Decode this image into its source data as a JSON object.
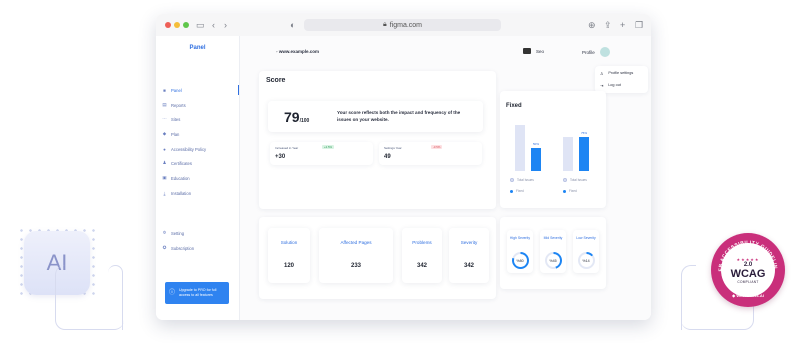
{
  "decor": {
    "ai_label": "AI"
  },
  "browser": {
    "url": "figma.com"
  },
  "app": {
    "site_url": "www.example.com",
    "sidebar": {
      "title": "Panel",
      "items": [
        {
          "label": "Panel",
          "icon": "dashboard-icon"
        },
        {
          "label": "Reports",
          "icon": "reports-icon"
        },
        {
          "label": "Sites",
          "icon": "sites-icon"
        },
        {
          "label": "Plan",
          "icon": "plan-icon"
        },
        {
          "label": "Accessibility Policy",
          "icon": "policy-icon"
        },
        {
          "label": "Certificates",
          "icon": "certificate-icon"
        },
        {
          "label": "Education",
          "icon": "education-icon"
        },
        {
          "label": "Installation",
          "icon": "installation-icon"
        },
        {
          "label": "Setting",
          "icon": "settings-icon"
        },
        {
          "label": "Subscription",
          "icon": "subscription-icon"
        }
      ],
      "upgrade_text": "Upgrade to PRO for full access to all features"
    },
    "header": {
      "lang_label": "Seo",
      "profile_label": "Profile"
    },
    "profile_menu": {
      "items": [
        "Profile settings",
        "Log out"
      ]
    },
    "score": {
      "title": "Score",
      "value": "79",
      "max": "/100",
      "description": "Your score reflects both the impact and frequency of the issues on your website.",
      "stats": [
        {
          "label": "Increased in Year",
          "delta": "+2.5%",
          "value": "+30"
        },
        {
          "label": "Settings Year",
          "delta": "-3.5%",
          "value": "49"
        }
      ]
    },
    "fixed": {
      "title": "Fixed",
      "legend": [
        "Total Issues",
        "Fixed"
      ]
    },
    "summary": {
      "headers": [
        "Solution",
        "Affected Pages",
        "Problems",
        "Severity"
      ],
      "values": [
        "120",
        "233",
        "342",
        "342"
      ]
    },
    "severity": [
      {
        "label": "High Severity",
        "value": "%80"
      },
      {
        "label": "Mid Severity",
        "value": "%45"
      },
      {
        "label": "Low Severity",
        "value": "%14"
      }
    ]
  },
  "chart_data": {
    "type": "bar",
    "title": "Fixed",
    "categories": [
      "",
      ""
    ],
    "series": [
      {
        "name": "Total Issues",
        "values": [
          100,
          75
        ]
      },
      {
        "name": "Fixed",
        "values": [
          50,
          75
        ]
      }
    ],
    "data_labels": [
      "50%",
      "75%"
    ],
    "colors": {
      "Total Issues": "#dfe4f5",
      "Fixed": "#1d85f3"
    }
  },
  "badge": {
    "ring_text": "WEB ACCESSIBILITY GUIDELINES",
    "version": "2.0",
    "name": "WCAG",
    "status": "COMPLIANT",
    "brand": "WebAssess.AI"
  },
  "colors": {
    "accent": "#2f6fe0",
    "badge": "#c92f7b",
    "bar_fixed": "#1d85f3"
  }
}
